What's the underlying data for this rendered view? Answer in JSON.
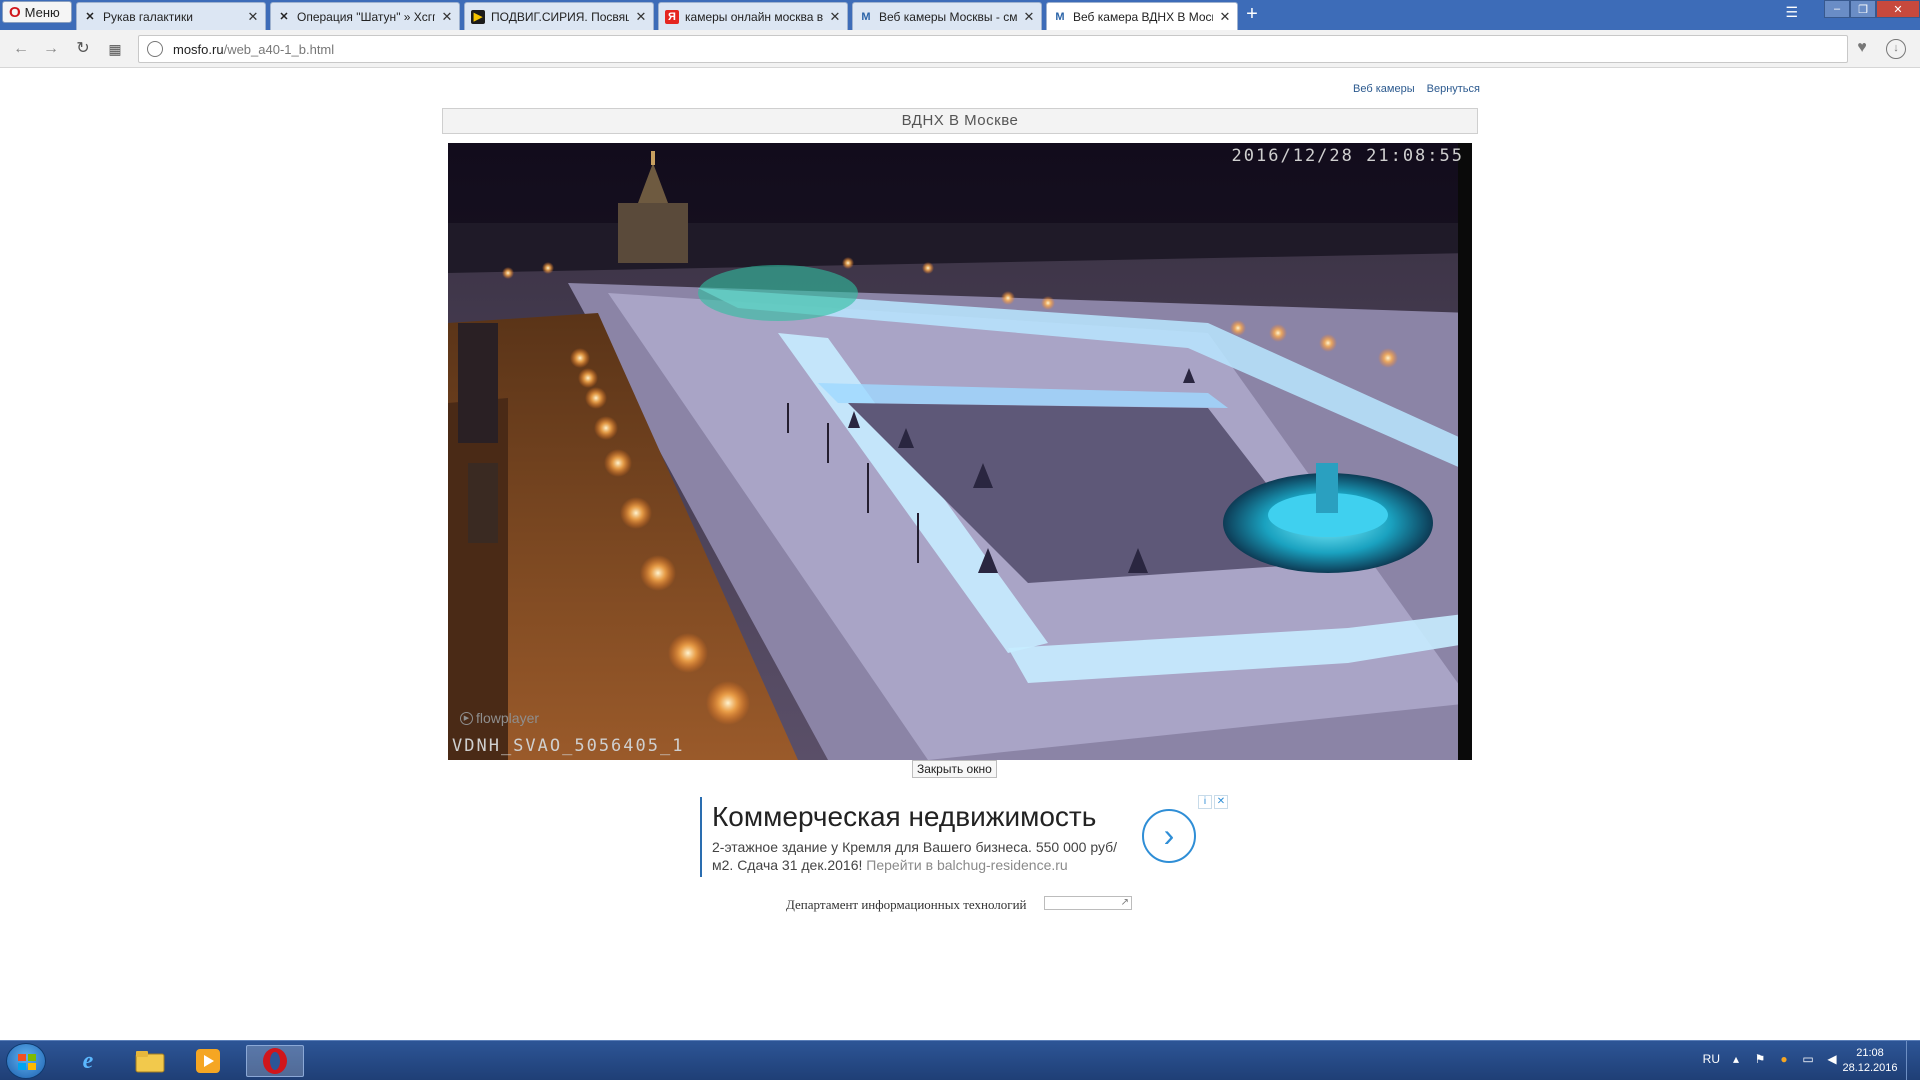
{
  "browser": {
    "menu_label": "Меню",
    "tabs": [
      {
        "title": "Рукав галактики",
        "icon": "alien-ship-icon"
      },
      {
        "title": "Операция \"Шатун\" » Хсгп",
        "icon": "alien-ship-icon"
      },
      {
        "title": "ПОДВИГ.СИРИЯ. Посвящ",
        "icon": "video-play-icon"
      },
      {
        "title": "камеры онлайн москва в",
        "icon": "yandex-icon"
      },
      {
        "title": "Веб камеры Москвы - см",
        "icon": "m-logo-icon"
      },
      {
        "title": "Веб камера ВДНХ В Моск",
        "icon": "m-logo-icon",
        "active": true
      }
    ],
    "url_domain": "mosfo.ru",
    "url_path": "/web_a40-1_b.html"
  },
  "page": {
    "links": [
      "Веб камеры",
      "Вернуться"
    ],
    "title": "ВДНХ В Москве",
    "camera": {
      "timestamp": "2016/12/28 21:08:55",
      "label": "VDNH_SVAO_5056405_1",
      "player_brand": "flowplayer"
    },
    "close_button": "Закрыть окно",
    "ad": {
      "headline": "Коммерческая недвижимость",
      "body": "2-этажное здание у Кремля для Вашего бизнеса. 550 000 руб/м2. Сдача 31 дек.2016!",
      "more": "Перейти в balchug-residence.ru"
    },
    "footer_text": "Департамент информационных технологий"
  },
  "taskbar": {
    "language": "RU",
    "time": "21:08",
    "date": "28.12.2016"
  },
  "colors": {
    "titlebar_blue": "#3d6cb8",
    "taskbar_blue": "#2d5596",
    "link_blue": "#2c5a8f",
    "ad_accent": "#2f8ed6"
  }
}
